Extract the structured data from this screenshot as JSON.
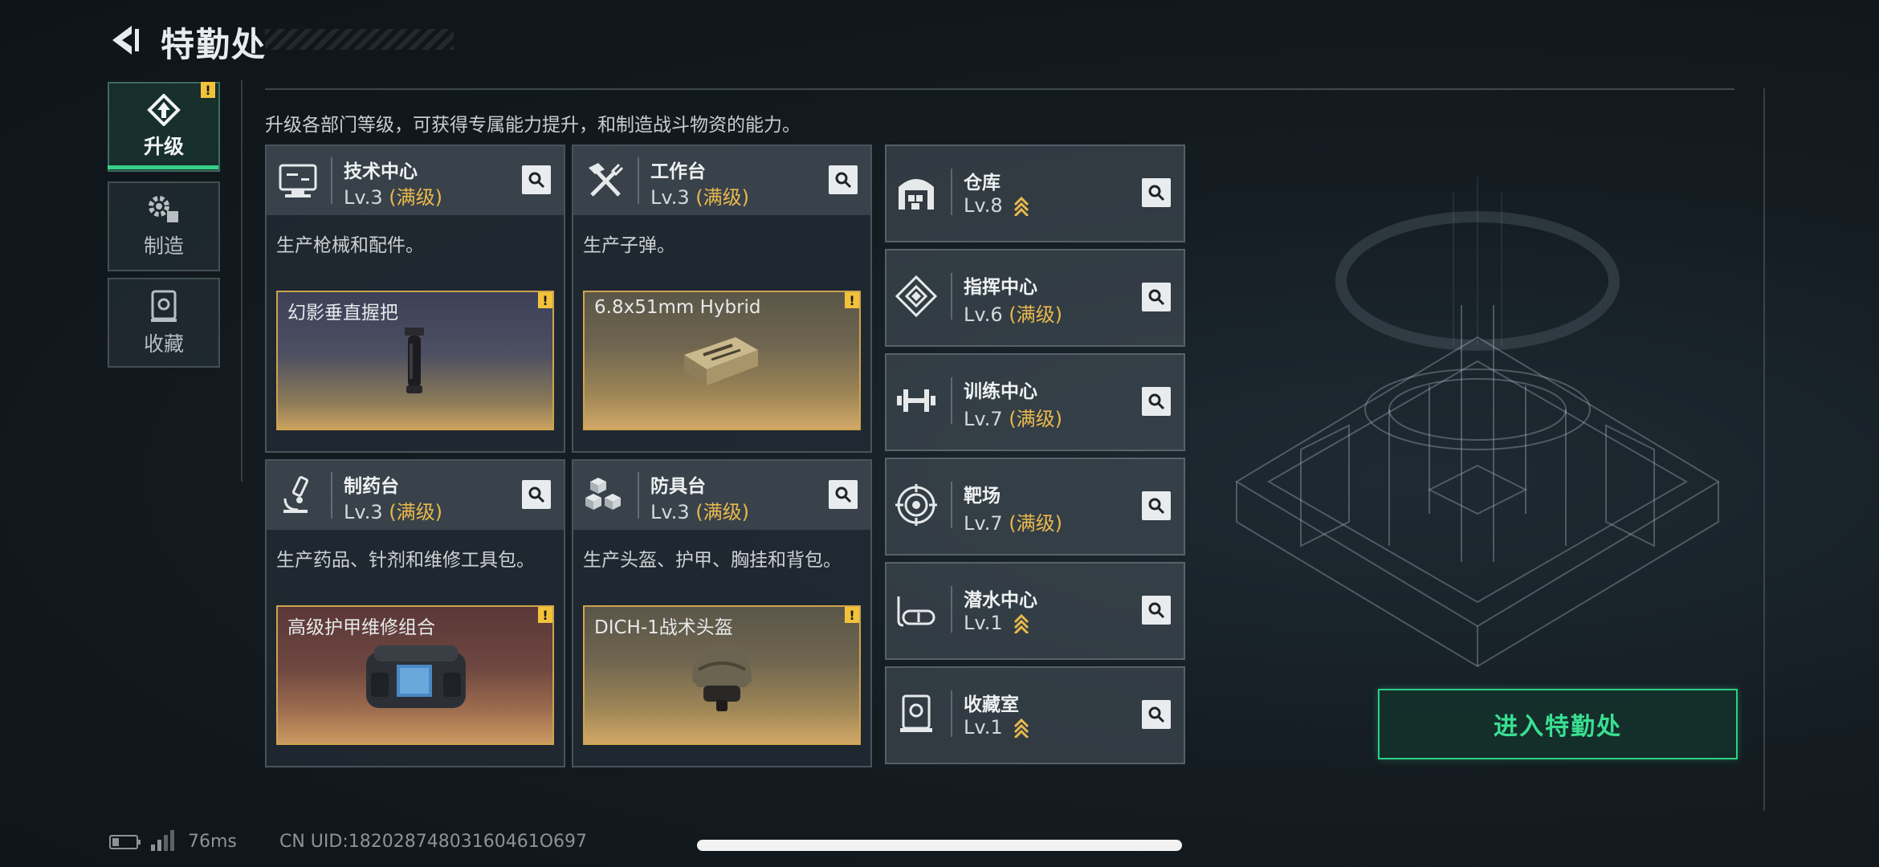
{
  "header": {
    "title": "特勤处"
  },
  "tabs": [
    {
      "label": "升级",
      "icon": "upgrade-icon",
      "active": true,
      "warning": "!"
    },
    {
      "label": "制造",
      "icon": "gears-icon",
      "active": false
    },
    {
      "label": "收藏",
      "icon": "collection-icon",
      "active": false
    }
  ],
  "description": "升级各部门等级，可获得专属能力提升，和制造战斗物资的能力。",
  "production": [
    {
      "name": "技术中心",
      "level": "Lv.3",
      "max": "(满级)",
      "desc": "生产枪械和配件。",
      "product": "幻影垂直握把",
      "warn": "!",
      "icon": "computer-icon"
    },
    {
      "name": "工作台",
      "level": "Lv.3",
      "max": "(满级)",
      "desc": "生产子弹。",
      "product": "6.8x51mm Hybrid",
      "warn": "!",
      "icon": "tools-icon"
    },
    {
      "name": "制药台",
      "level": "Lv.3",
      "max": "(满级)",
      "desc": "生产药品、针剂和维修工具包。",
      "product": "高级护甲维修组合",
      "warn": "!",
      "icon": "microscope-icon"
    },
    {
      "name": "防具台",
      "level": "Lv.3",
      "max": "(满级)",
      "desc": "生产头盔、护甲、胸挂和背包。",
      "product": "DICH-1战术头盔",
      "warn": "!",
      "icon": "cubes-icon"
    }
  ],
  "facilities": [
    {
      "name": "仓库",
      "level": "Lv.8",
      "max": "",
      "upgradable": true,
      "icon": "warehouse-icon"
    },
    {
      "name": "指挥中心",
      "level": "Lv.6",
      "max": "(满级)",
      "upgradable": false,
      "icon": "command-icon"
    },
    {
      "name": "训练中心",
      "level": "Lv.7",
      "max": "(满级)",
      "upgradable": false,
      "icon": "dumbbell-icon"
    },
    {
      "name": "靶场",
      "level": "Lv.7",
      "max": "(满级)",
      "upgradable": false,
      "icon": "target-icon"
    },
    {
      "name": "潜水中心",
      "level": "Lv.1",
      "max": "",
      "upgradable": true,
      "icon": "diving-mask-icon"
    },
    {
      "name": "收藏室",
      "level": "Lv.1",
      "max": "",
      "upgradable": true,
      "icon": "trophy-case-icon"
    }
  ],
  "enter_button": "进入特勤处",
  "status": {
    "ping": "76ms",
    "uid": "CN UID:18202874803160461O697"
  },
  "colors": {
    "accent": "#2fcf86",
    "max_level": "#e9b94d",
    "warning": "#f2c23a"
  }
}
